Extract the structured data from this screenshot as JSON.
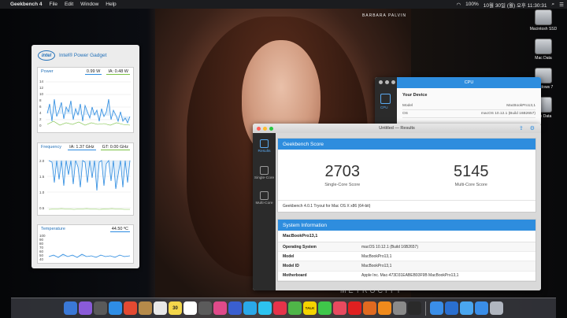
{
  "menubar": {
    "app": "Geekbench 4",
    "items": [
      "File",
      "Edit",
      "Window",
      "Help"
    ],
    "battery": "100%",
    "datetime": "10월 30일 (월) 오후 11:30:31"
  },
  "photo": {
    "caption": "BARBARA PALVIN",
    "bottom_text": "METROCITY"
  },
  "desktop": {
    "icons": [
      "Macintosh SSD",
      "Mac Data",
      "Windows 7",
      "Win Data"
    ]
  },
  "power_gadget": {
    "title": "Intel® Power Gadget",
    "logo": "intel",
    "power": {
      "label": "Power",
      "value1": "0.99 W",
      "value2": "IA: 0.48 W",
      "yticks": [
        "14",
        "12",
        "10",
        "8",
        "6",
        "4",
        "2",
        "0"
      ]
    },
    "frequency": {
      "label": "Frequency",
      "value1": "IA: 1.37 GHz",
      "value2": "GT: 0.00 GHz",
      "yticks": [
        "2.0",
        "1.5",
        "1.0",
        "0.5"
      ]
    },
    "temperature": {
      "label": "Temperature",
      "value1": "44.50 ºC",
      "yticks": [
        "100",
        "90",
        "80",
        "70",
        "60",
        "50",
        "40"
      ]
    }
  },
  "cpu_window": {
    "title": "CPU",
    "sidebar_label": "CPU",
    "section": "Your Device",
    "rows": [
      {
        "k": "Model",
        "v": "MacBookPro13,1"
      },
      {
        "k": "OS",
        "v": "macOS 10.12.1 (Build 16B2657)"
      }
    ]
  },
  "results_window": {
    "title": "Untitled — Results",
    "sidebar": [
      {
        "label": "Results",
        "active": true
      },
      {
        "label": "Single-Core",
        "active": false
      },
      {
        "label": "Multi-Core",
        "active": false
      }
    ],
    "score_card": {
      "header": "Geekbench Score",
      "single_score": "2703",
      "single_label": "Single-Core Score",
      "multi_score": "5145",
      "multi_label": "Multi-Core Score",
      "tryout": "Geekbench 4.0.1 Tryout for Mac OS X x86 (64-bit)"
    },
    "system_info": {
      "header": "System Information",
      "subheader": "MacBookPro13,1",
      "rows": [
        {
          "k": "Operating System",
          "v": "macOS 10.12.1 (Build 16B2657)"
        },
        {
          "k": "Model",
          "v": "MacBookPro13,1"
        },
        {
          "k": "Model ID",
          "v": "MacBookPro13,1"
        },
        {
          "k": "Motherboard",
          "v": "Apple Inc. Mac-473D31EABEB93F9B MacBookPro13,1"
        }
      ]
    }
  },
  "dock": {
    "calendar_day": "30",
    "talk_label": "TALK",
    "colors": [
      "#3a78d6",
      "#8a5bd8",
      "#5a5a5a",
      "#2e8de6",
      "#e34a32",
      "#b58a4a",
      "#e8e8e8",
      "#f3d64b",
      "#ffffff",
      "#5b5b5b",
      "#e04a8a",
      "#3a5fd0",
      "#2aa8e8",
      "#2dc3f0",
      "#e6334a",
      "#4fb548",
      "#f5d300",
      "#3fc74a",
      "#e84a5f",
      "#e02020",
      "#e06a20",
      "#f08a1c",
      "#8a8a8a",
      "#2a2a2a",
      "#3a8ee8",
      "#2a6fd0",
      "#4aa6f0",
      "#3a8ee8",
      "#b0b6c0"
    ]
  }
}
